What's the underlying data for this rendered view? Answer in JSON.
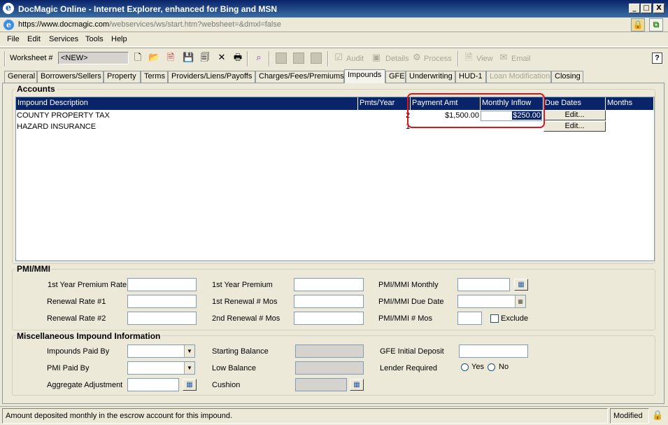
{
  "window": {
    "title": "DocMagic Online - Internet Explorer, enhanced for Bing and MSN",
    "minimize_glyph": "_",
    "maximize_glyph": "□",
    "close_glyph": "X"
  },
  "address": {
    "url_scheme": "https://www.",
    "url_domain": "docmagic.com",
    "url_path": "/webservices/ws/start.htm?websheet=&dmxl=false"
  },
  "menu": [
    "File",
    "Edit",
    "Services",
    "Tools",
    "Help"
  ],
  "toolbar": {
    "worksheet_label": "Worksheet #",
    "worksheet_value": "<NEW>",
    "audit": "Audit",
    "details": "Details",
    "process": "Process",
    "view": "View",
    "email": "Email",
    "help": "?"
  },
  "tabs": [
    {
      "label": "General"
    },
    {
      "label": "Borrowers/Sellers"
    },
    {
      "label": "Property"
    },
    {
      "label": "Terms"
    },
    {
      "label": "Providers/Liens/Payoffs"
    },
    {
      "label": "Charges/Fees/Premiums"
    },
    {
      "label": "Impounds",
      "active": true
    },
    {
      "label": "GFE"
    },
    {
      "label": "Underwriting"
    },
    {
      "label": "HUD-1"
    },
    {
      "label": "Loan Modification",
      "disabled": true
    },
    {
      "label": "Closing"
    }
  ],
  "accounts": {
    "title": "Accounts",
    "columns": [
      "Impound Description",
      "Pmts/Year",
      "Payment Amt",
      "Monthly Inflow",
      "Due Dates",
      "Months"
    ],
    "rows": [
      {
        "description": "COUNTY PROPERTY TAX",
        "pmts_year": "2",
        "payment_amt": "$1,500.00",
        "monthly_inflow": "$250.00",
        "due_dates": "Edit..."
      },
      {
        "description": "HAZARD INSURANCE",
        "pmts_year": "1",
        "payment_amt": "",
        "monthly_inflow": "",
        "due_dates": "Edit..."
      }
    ]
  },
  "pmi": {
    "title": "PMI/MMI",
    "first_year_premium_rate": "1st Year Premium Rate",
    "renewal_rate_1": "Renewal Rate #1",
    "renewal_rate_2": "Renewal Rate #2",
    "first_year_premium": "1st Year Premium",
    "first_renewal_mos": "1st Renewal # Mos",
    "second_renewal_mos": "2nd Renewal # Mos",
    "monthly": "PMI/MMI Monthly",
    "due_date": "PMI/MMI Due Date",
    "num_mos": "PMI/MMI # Mos",
    "exclude": "Exclude"
  },
  "misc": {
    "title": "Miscellaneous Impound Information",
    "impounds_paid_by": "Impounds Paid By",
    "pmi_paid_by": "PMI Paid By",
    "aggregate_adjustment": "Aggregate Adjustment",
    "starting_balance": "Starting Balance",
    "low_balance": "Low Balance",
    "cushion": "Cushion",
    "gfe_initial_deposit": "GFE Initial Deposit",
    "lender_required": "Lender Required",
    "yes": "Yes",
    "no": "No"
  },
  "status": {
    "message": "Amount deposited monthly in the escrow account for this impound.",
    "state": "Modified"
  }
}
